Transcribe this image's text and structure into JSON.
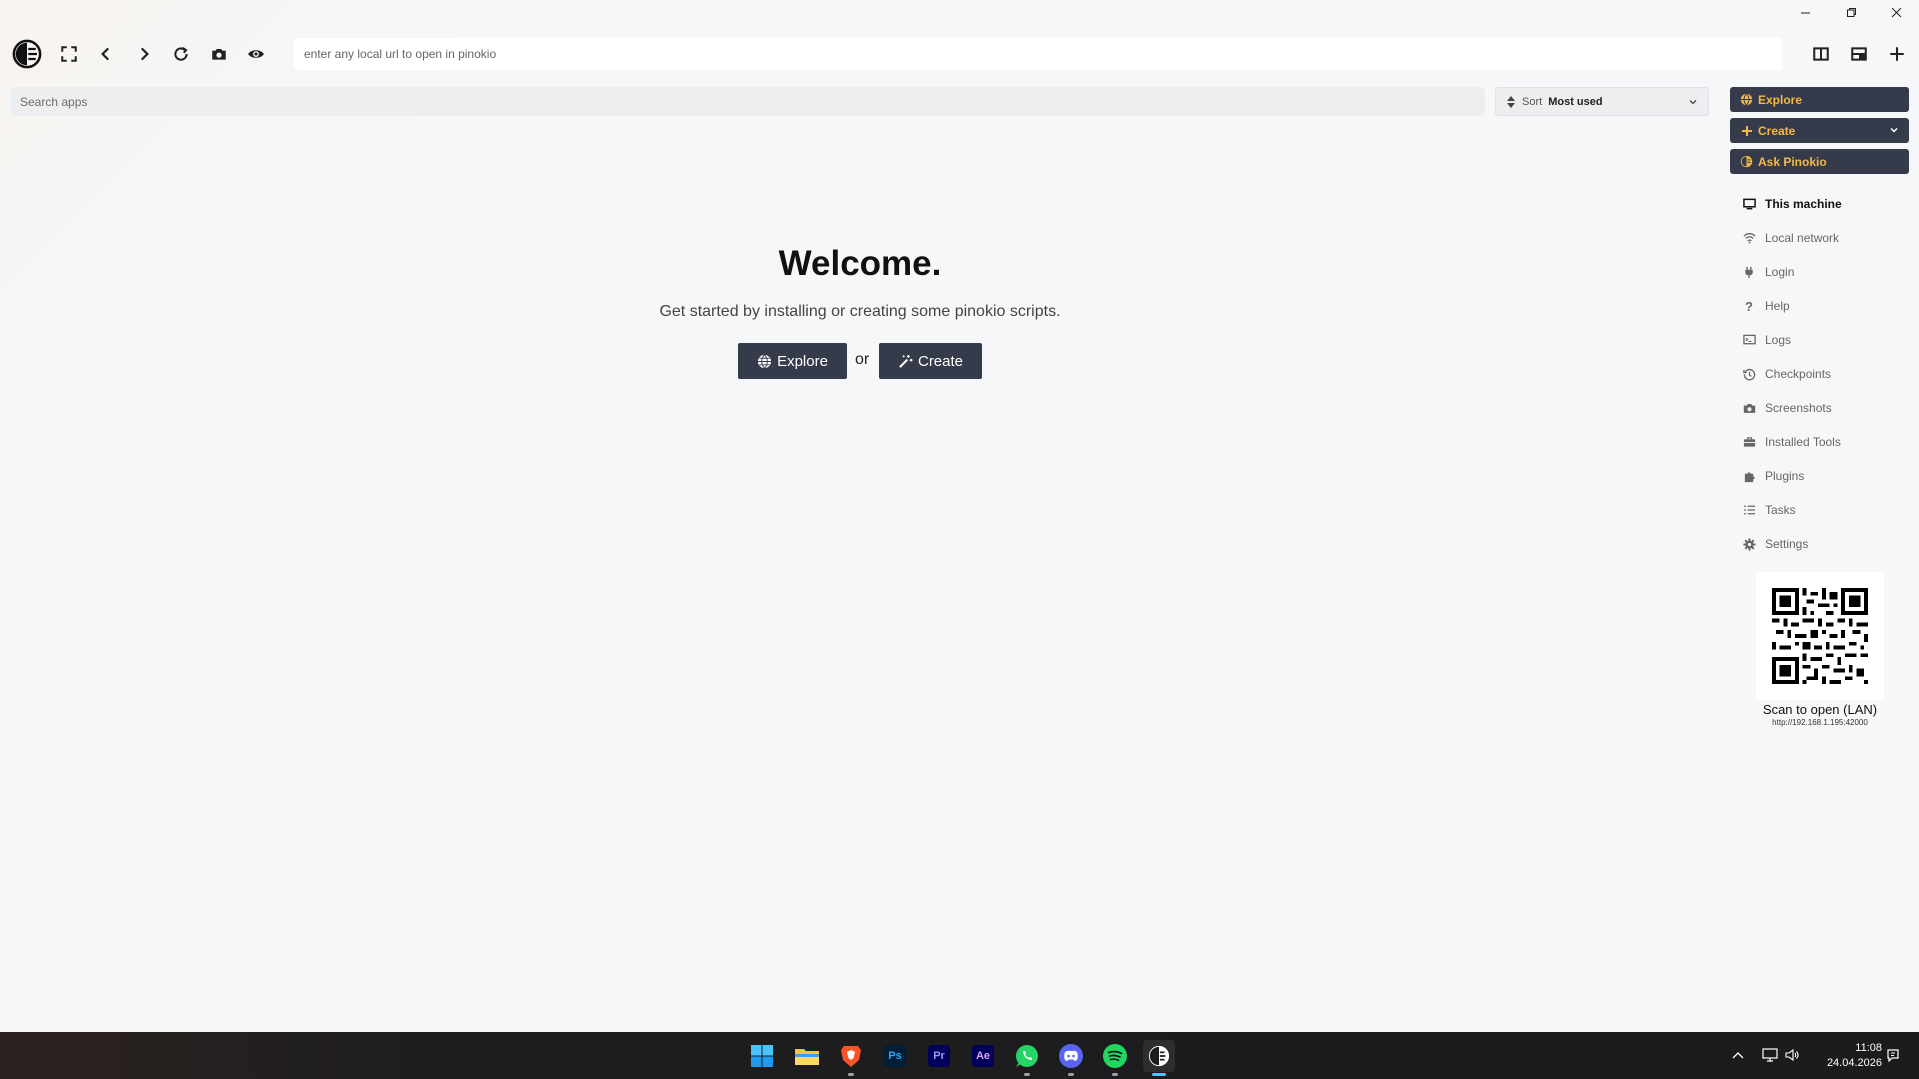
{
  "toolbar": {
    "url_placeholder": "enter any local url to open in pinokio"
  },
  "search": {
    "placeholder": "Search apps",
    "sort_label": "Sort",
    "sort_value": "Most used"
  },
  "sidebar": {
    "buttons": {
      "explore": "Explore",
      "create": "Create",
      "ask": "Ask Pinokio"
    },
    "items": [
      {
        "label": "This machine",
        "icon": "monitor-icon"
      },
      {
        "label": "Local network",
        "icon": "wifi-icon"
      },
      {
        "label": "Login",
        "icon": "plug-icon"
      },
      {
        "label": "Help",
        "icon": "question-icon"
      },
      {
        "label": "Logs",
        "icon": "terminal-icon"
      },
      {
        "label": "Checkpoints",
        "icon": "history-icon"
      },
      {
        "label": "Screenshots",
        "icon": "camera-icon"
      },
      {
        "label": "Installed Tools",
        "icon": "toolbox-icon"
      },
      {
        "label": "Plugins",
        "icon": "puzzle-icon"
      },
      {
        "label": "Tasks",
        "icon": "list-icon"
      },
      {
        "label": "Settings",
        "icon": "gear-icon"
      }
    ],
    "qr_caption": "Scan to open (LAN)",
    "qr_url": "http://192.168.1.195:42000"
  },
  "main": {
    "title": "Welcome.",
    "subtitle": "Get started by installing or creating some pinokio scripts.",
    "explore_label": "Explore",
    "or_text": "or",
    "create_label": "Create"
  },
  "taskbar": {
    "time": "11:08",
    "date": "24.04.2026",
    "apps": [
      {
        "name": "start-icon"
      },
      {
        "name": "file-explorer-icon"
      },
      {
        "name": "brave-icon"
      },
      {
        "name": "photoshop-icon",
        "text": "Ps"
      },
      {
        "name": "premiere-icon",
        "text": "Pr"
      },
      {
        "name": "after-effects-icon",
        "text": "Ae"
      },
      {
        "name": "whatsapp-icon"
      },
      {
        "name": "discord-icon"
      },
      {
        "name": "spotify-icon"
      },
      {
        "name": "pinokio-icon"
      }
    ]
  },
  "colors": {
    "accent_dark": "#353b4b",
    "accent_gold": "#f5b942"
  }
}
